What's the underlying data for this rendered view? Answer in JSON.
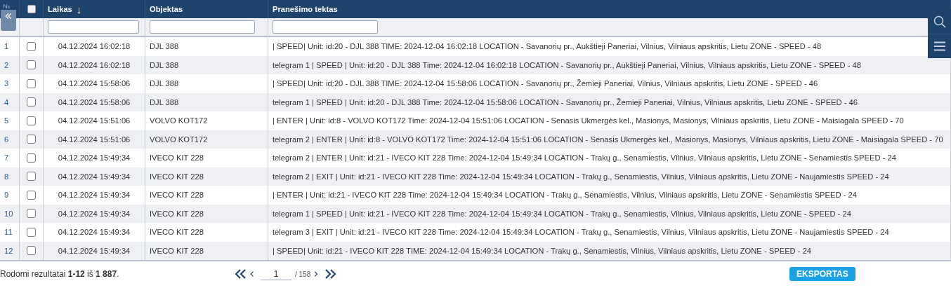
{
  "table": {
    "select_all": {
      "checked": false
    },
    "columns": [
      {
        "label": "№",
        "kind": "number"
      },
      {
        "kind": "check"
      },
      {
        "label": "Laikas",
        "kind": "time",
        "sort": "↓",
        "filter": true
      },
      {
        "label": "Objektas",
        "kind": "object",
        "filter": true
      },
      {
        "label": "Pranešimo tektas",
        "kind": "message",
        "filter": true
      }
    ],
    "rows": [
      {
        "number": "1",
        "checked": false,
        "time": "04.12.2024 16:02:18",
        "object": "DJL 388",
        "message": "| SPEED| Unit: id:20 - DJL 388 TIME: 2024-12-04 16:02:18 LOCATION - Savanorių pr., Aukštieji Paneriai, Vilnius, Vilniaus apskritis, Lietu ZONE - SPEED - 48"
      },
      {
        "number": "2",
        "checked": false,
        "time": "04.12.2024 16:02:18",
        "object": "DJL 388",
        "message": "telegram 1 | SPEED | Unit: id:20 - DJL 388 Time: 2024-12-04 16:02:18 LOCATION - Savanorių pr., Aukštieji Paneriai, Vilnius, Vilniaus apskritis, Lietu ZONE - SPEED - 48"
      },
      {
        "number": "3",
        "checked": false,
        "time": "04.12.2024 15:58:06",
        "object": "DJL 388",
        "message": "| SPEED| Unit: id:20 - DJL 388 TIME: 2024-12-04 15:58:06 LOCATION - Savanorių pr., Žemieji Paneriai, Vilnius, Vilniaus apskritis, Lietu ZONE - SPEED - 46"
      },
      {
        "number": "4",
        "checked": false,
        "time": "04.12.2024 15:58:06",
        "object": "DJL 388",
        "message": "telegram 1 | SPEED | Unit: id:20 - DJL 388 Time: 2024-12-04 15:58:06 LOCATION - Savanorių pr., Žemieji Paneriai, Vilnius, Vilniaus apskritis, Lietu ZONE - SPEED - 46"
      },
      {
        "number": "5",
        "checked": false,
        "time": "04.12.2024 15:51:06",
        "object": "VOLVO KOT172",
        "message": "| ENTER | Unit: id:8 - VOLVO KOT172 Time: 2024-12-04 15:51:06 LOCATION - Senasis Ukmergės kel., Masionys, Masionys, Vilniaus apskritis, Lietu ZONE - Maisiagala SPEED - 70"
      },
      {
        "number": "6",
        "checked": false,
        "time": "04.12.2024 15:51:06",
        "object": "VOLVO KOT172",
        "message": "telegram 2 | ENTER | Unit: id:8 - VOLVO KOT172 Time: 2024-12-04 15:51:06 LOCATION - Senasis Ukmergės kel., Masionys, Masionys, Vilniaus apskritis, Lietu ZONE - Maisiagala SPEED - 70"
      },
      {
        "number": "7",
        "checked": false,
        "time": "04.12.2024 15:49:34",
        "object": "IVECO KIT 228",
        "message": "telegram 2 | ENTER | Unit: id:21 - IVECO KIT 228 Time: 2024-12-04 15:49:34 LOCATION - Trakų g., Senamiestis, Vilnius, Vilniaus apskritis, Lietu ZONE - Senamiestis SPEED - 24"
      },
      {
        "number": "8",
        "checked": false,
        "time": "04.12.2024 15:49:34",
        "object": "IVECO KIT 228",
        "message": "telegram 2 | EXIT | Unit: id:21 - IVECO KIT 228 Time: 2024-12-04 15:49:34 LOCATION - Trakų g., Senamiestis, Vilnius, Vilniaus apskritis, Lietu ZONE - Naujamiestis SPEED - 24"
      },
      {
        "number": "9",
        "checked": false,
        "time": "04.12.2024 15:49:34",
        "object": "IVECO KIT 228",
        "message": "| ENTER | Unit: id:21 - IVECO KIT 228 Time: 2024-12-04 15:49:34 LOCATION - Trakų g., Senamiestis, Vilnius, Vilniaus apskritis, Lietu ZONE - Senamiestis SPEED - 24"
      },
      {
        "number": "10",
        "checked": false,
        "time": "04.12.2024 15:49:34",
        "object": "IVECO KIT 228",
        "message": "telegram 1 | SPEED | Unit: id:21 - IVECO KIT 228 Time: 2024-12-04 15:49:34 LOCATION - Trakų g., Senamiestis, Vilnius, Vilniaus apskritis, Lietu ZONE - SPEED - 24"
      },
      {
        "number": "11",
        "checked": false,
        "time": "04.12.2024 15:49:34",
        "object": "IVECO KIT 228",
        "message": "telegram 3 | EXIT | Unit: id:21 - IVECO KIT 228 Time: 2024-12-04 15:49:34 LOCATION - Trakų g., Senamiestis, Vilnius, Vilniaus apskritis, Lietu ZONE - Naujamiestis SPEED - 24"
      },
      {
        "number": "12",
        "checked": false,
        "time": "04.12.2024 15:49:34",
        "object": "IVECO KIT 228",
        "message": "| SPEED| Unit: id:21 - IVECO KIT 228 TIME: 2024-12-04 15:49:34 LOCATION - Trakų g., Senamiestis, Vilnius, Vilniaus apskritis, Lietu ZONE - SPEED - 24"
      }
    ]
  },
  "footer": {
    "summary": "Rodomi rezultatai **1-12** iš **1 887**.",
    "page": "1",
    "pages": "/ 158",
    "export_button": "EKSPORTAS"
  }
}
